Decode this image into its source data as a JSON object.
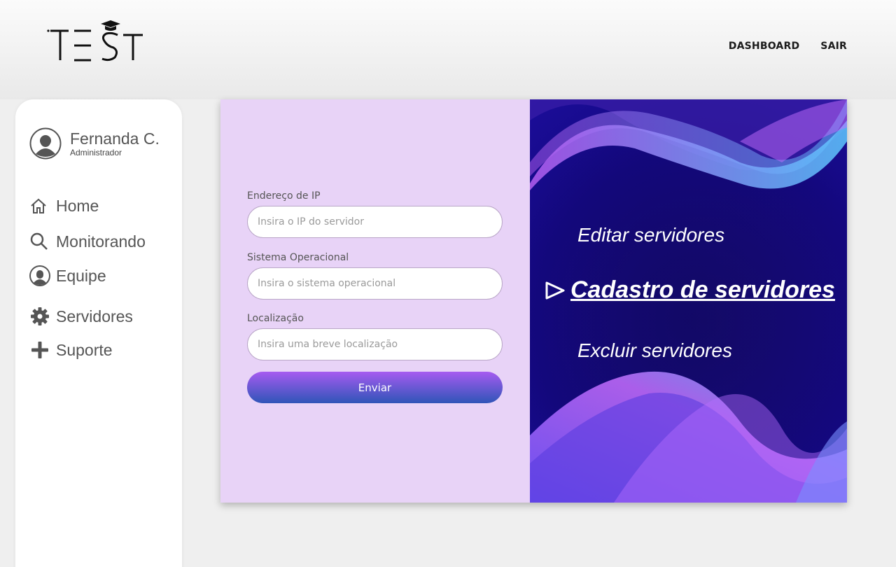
{
  "header": {
    "logo_text": "TEST",
    "nav": [
      {
        "label": "DASHBOARD"
      },
      {
        "label": "SAIR"
      }
    ]
  },
  "sidebar": {
    "user": {
      "name": "Fernanda C.",
      "role": "Administrador",
      "icon": "user-avatar-icon"
    },
    "items": [
      {
        "label": "Home",
        "icon": "home-icon"
      },
      {
        "label": "Monitorando",
        "icon": "search-icon"
      },
      {
        "label": "Equipe",
        "icon": "user-icon"
      },
      {
        "label": "Servidores",
        "icon": "gear-icon"
      },
      {
        "label": "Suporte",
        "icon": "plus-icon"
      }
    ]
  },
  "form": {
    "fields": [
      {
        "label": "Endereço de IP",
        "placeholder": "Insira o IP do servidor",
        "value": ""
      },
      {
        "label": "Sistema Operacional",
        "placeholder": "Insira o sistema operacional",
        "value": ""
      },
      {
        "label": "Localização",
        "placeholder": "Insira uma breve localização",
        "value": ""
      }
    ],
    "submit_label": "Enviar"
  },
  "actions": {
    "edit": "Editar servidores",
    "register": "Cadastro de servidores",
    "delete": "Excluir servidores"
  },
  "colors": {
    "form_bg": "#e8d3f7",
    "art_bg": "#140880",
    "button_top": "#a65bf0",
    "button_bottom": "#2f55b8"
  }
}
